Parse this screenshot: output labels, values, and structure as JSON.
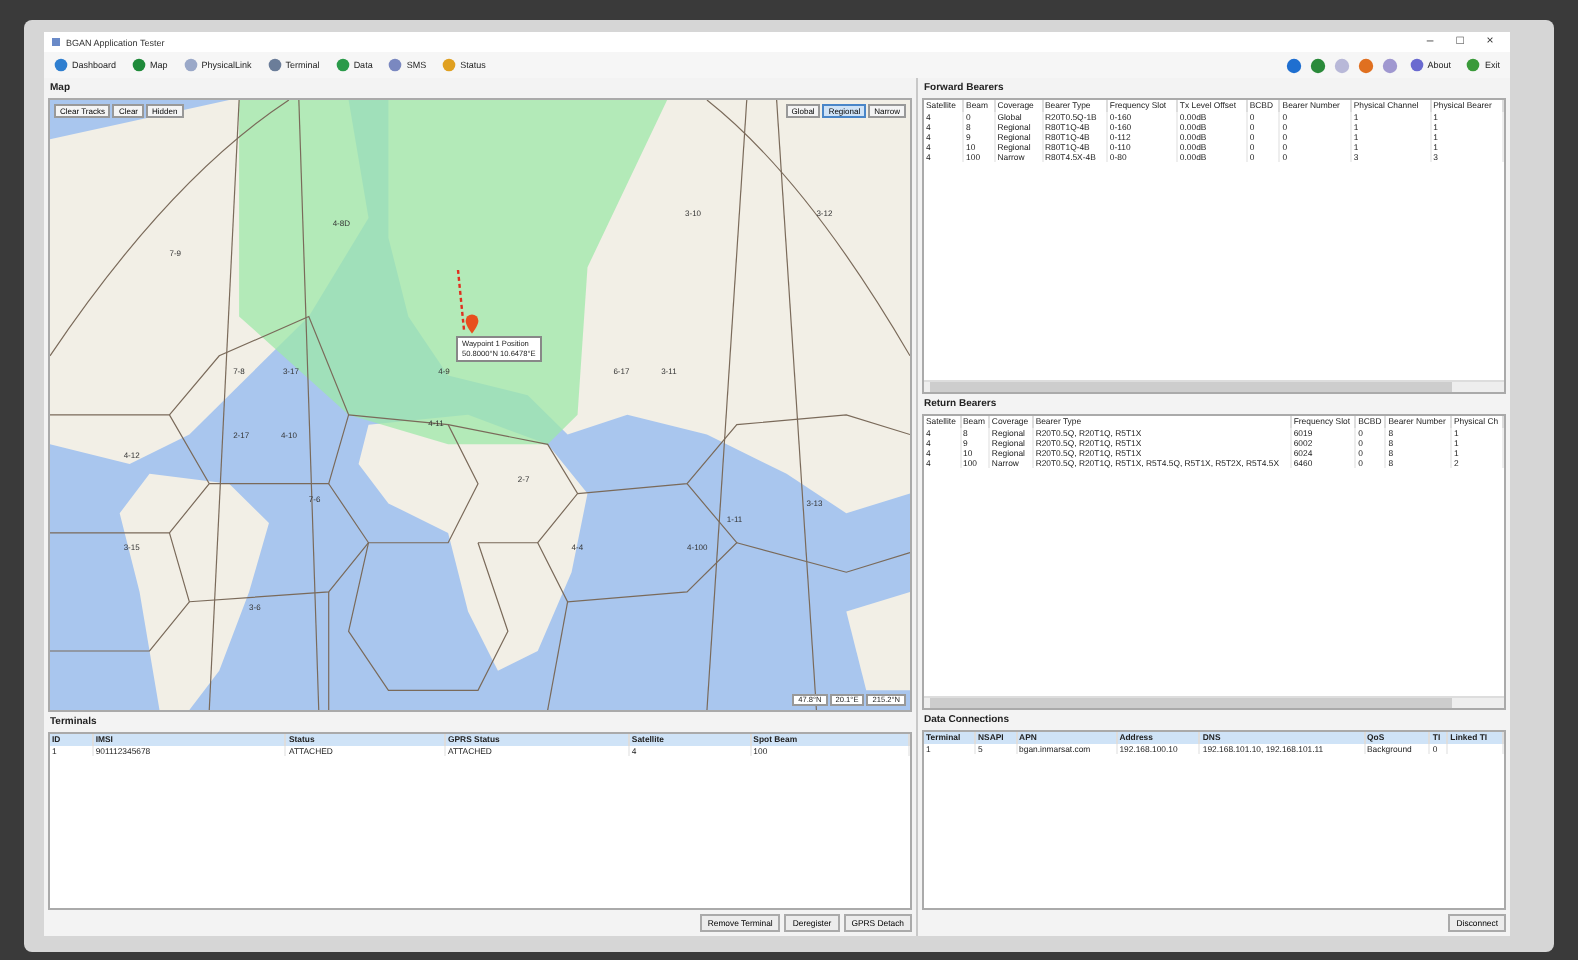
{
  "window": {
    "title": "BGAN Application Tester",
    "controls": [
      "–",
      "□",
      "×"
    ]
  },
  "toolbar": {
    "items": [
      "Dashboard",
      "Map",
      "PhysicalLink",
      "Terminal",
      "Data",
      "SMS",
      "Status"
    ],
    "right_items": [
      "About",
      "Exit"
    ]
  },
  "map": {
    "title": "Map",
    "left_buttons": [
      "Clear Tracks",
      "Clear",
      "Hidden"
    ],
    "coverage_buttons": [
      {
        "label": "Global",
        "selected": false
      },
      {
        "label": "Regional",
        "selected": true
      },
      {
        "label": "Narrow",
        "selected": false
      }
    ],
    "beam_labels": [
      "7-9",
      "4-8D",
      "7-8",
      "3-17",
      "4-9",
      "2-17",
      "4-10",
      "4-11",
      "6-17",
      "3-11",
      "3-10",
      "3-12",
      "4-12",
      "3-15",
      "7-6",
      "2-7",
      "1-11",
      "4-4",
      "3-13",
      "4-100",
      "3-6"
    ],
    "marker": {
      "name": "Waypoint 1 Position",
      "position": "50.8000°N 10.6478°E"
    },
    "coordinates": [
      "47.8°N",
      "20.1°E",
      "215.2°N"
    ]
  },
  "forward_bearers": {
    "title": "Forward Bearers",
    "columns": [
      "Satellite",
      "Beam",
      "Coverage",
      "Bearer Type",
      "Frequency Slot",
      "Tx Level Offset",
      "BCBD",
      "Bearer Number",
      "Physical Channel",
      "Physical Bearer"
    ],
    "rows": [
      [
        "4",
        "0",
        "Global",
        "R20T0.5Q-1B",
        "0-160",
        "0.00dB",
        "0",
        "0",
        "1",
        "1"
      ],
      [
        "4",
        "8",
        "Regional",
        "R80T1Q-4B",
        "0-160",
        "0.00dB",
        "0",
        "0",
        "1",
        "1"
      ],
      [
        "4",
        "9",
        "Regional",
        "R80T1Q-4B",
        "0-112",
        "0.00dB",
        "0",
        "0",
        "1",
        "1"
      ],
      [
        "4",
        "10",
        "Regional",
        "R80T1Q-4B",
        "0-110",
        "0.00dB",
        "0",
        "0",
        "1",
        "1"
      ],
      [
        "4",
        "100",
        "Narrow",
        "R80T4.5X-4B",
        "0-80",
        "0.00dB",
        "0",
        "0",
        "3",
        "3"
      ]
    ]
  },
  "return_bearers": {
    "title": "Return Bearers",
    "columns": [
      "Satellite",
      "Beam",
      "Coverage",
      "Bearer Type",
      "Frequency Slot",
      "BCBD",
      "Bearer Number",
      "Physical Ch"
    ],
    "rows": [
      [
        "4",
        "8",
        "Regional",
        "R20T0.5Q, R20T1Q, R5T1X",
        "6019",
        "0",
        "8",
        "1"
      ],
      [
        "4",
        "9",
        "Regional",
        "R20T0.5Q, R20T1Q, R5T1X",
        "6002",
        "0",
        "8",
        "1"
      ],
      [
        "4",
        "10",
        "Regional",
        "R20T0.5Q, R20T1Q, R5T1X",
        "6024",
        "0",
        "8",
        "1"
      ],
      [
        "4",
        "100",
        "Narrow",
        "R20T0.5Q, R20T1Q, R5T1X, R5T4.5Q, R5T1X, R5T2X, R5T4.5X",
        "6460",
        "0",
        "8",
        "2"
      ]
    ]
  },
  "terminals": {
    "title": "Terminals",
    "columns": [
      "ID",
      "IMSI",
      "Status",
      "GPRS Status",
      "Satellite",
      "Spot Beam"
    ],
    "rows": [
      [
        "1",
        "901112345678",
        "ATTACHED",
        "ATTACHED",
        "4",
        "100"
      ]
    ],
    "buttons": [
      "Remove Terminal",
      "Deregister",
      "GPRS Detach"
    ]
  },
  "data_connections": {
    "title": "Data Connections",
    "columns": [
      "Terminal",
      "NSAPI",
      "APN",
      "Address",
      "DNS",
      "QoS",
      "TI",
      "Linked TI"
    ],
    "rows": [
      [
        "1",
        "5",
        "bgan.inmarsat.com",
        "192.168.100.10",
        "192.168.101.10, 192.168.101.11",
        "Background",
        "0",
        ""
      ]
    ],
    "buttons": [
      "Disconnect"
    ]
  }
}
